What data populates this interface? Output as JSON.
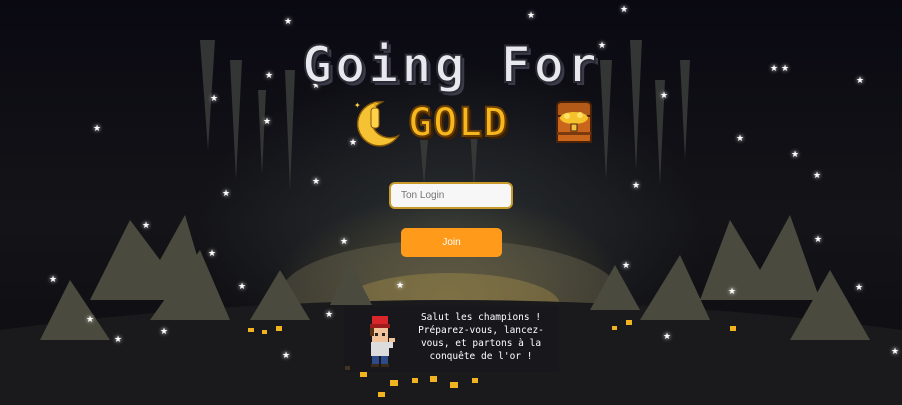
{
  "title": {
    "line1": "Going For",
    "line2": "GOLD"
  },
  "login": {
    "placeholder": "Ton Login",
    "value": ""
  },
  "join_button": {
    "label": "Join"
  },
  "speech": {
    "lines": [
      "Salut les champions !",
      "Préparez-vous, lancez-",
      "vous, et partons à la",
      "conquête de l'or !"
    ]
  },
  "colors": {
    "accent": "#ff9a1a",
    "gold": "#f6b81c",
    "input_border": "#c79a2a",
    "background": "#0b0a12"
  },
  "icons": [
    "moon-icon",
    "treasure-chest-icon",
    "miner-avatar-icon",
    "star-icon"
  ]
}
